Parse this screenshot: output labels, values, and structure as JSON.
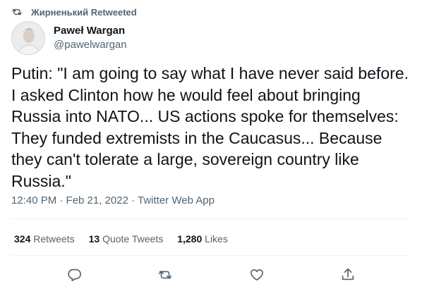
{
  "retweet_banner": {
    "icon": "retweet-icon",
    "text": "Жирненький Retweeted"
  },
  "author": {
    "display_name": "Paweł Wargan",
    "handle": "@pawelwargan"
  },
  "tweet": {
    "text": "Putin: \"I am going to say what I have never said before. I asked Clinton how he would feel about bringing Russia into NATO... US actions spoke for themselves: They funded extremists in the Caucasus... Because they can't tolerate a large, sovereign country like Russia.\"",
    "meta": "12:40 PM · Feb 21, 2022 · Twitter Web App"
  },
  "stats": {
    "retweets_count": "324",
    "retweets_label": "Retweets",
    "quotes_count": "13",
    "quotes_label": "Quote Tweets",
    "likes_count": "1,280",
    "likes_label": "Likes"
  },
  "actions": [
    "reply-icon",
    "retweet-icon",
    "like-icon",
    "share-icon"
  ],
  "colors": {
    "text": "#0f1419",
    "secondary": "#536471",
    "divider": "#eff3f4"
  }
}
